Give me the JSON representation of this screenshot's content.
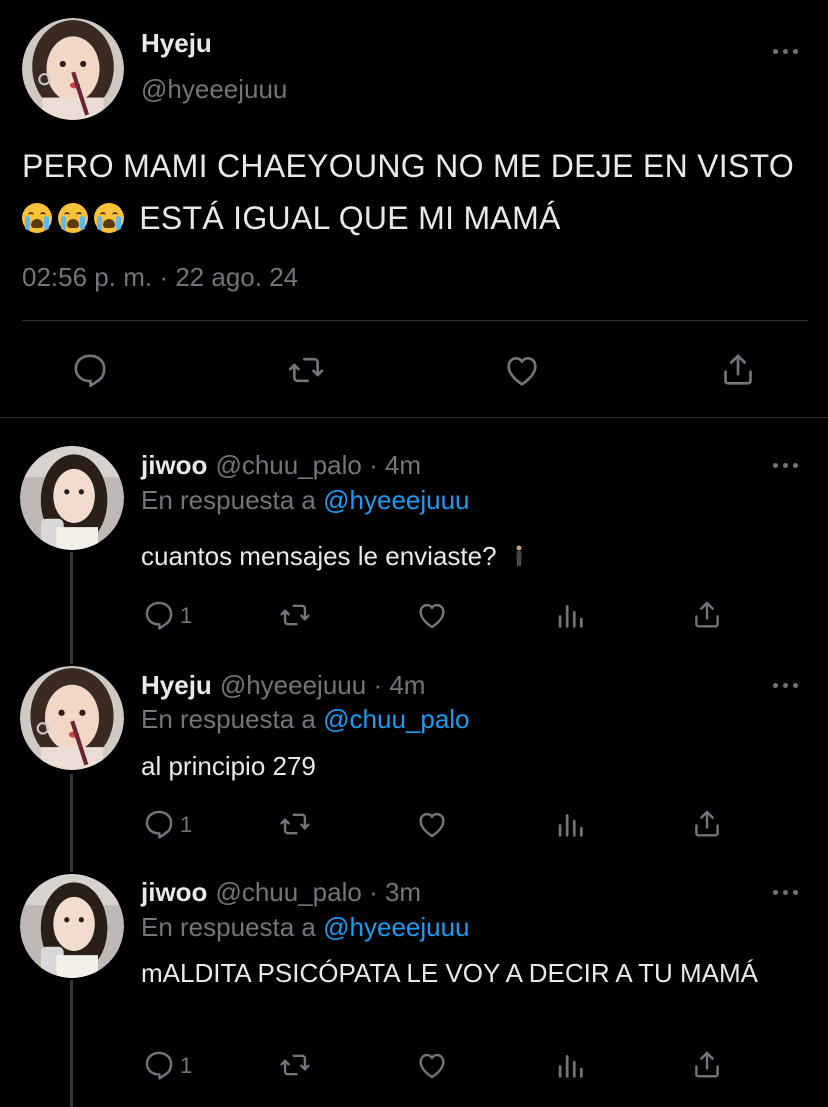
{
  "main_tweet": {
    "author_name": "Hyeju",
    "author_handle": "@hyeeejuuu",
    "text_part1": "PERO MAMI CHAEYOUNG NO ME DEJE EN VISTO",
    "emoji": "loudly-crying-face",
    "emoji_count": 3,
    "text_part2": "ESTÁ IGUAL QUE MI MAMÁ",
    "time": "02:56 p. m.",
    "separator": "·",
    "date": "22 ago. 24",
    "actions": [
      "reply-icon",
      "retweet-icon",
      "like-icon",
      "share-icon"
    ]
  },
  "replies": [
    {
      "name": "jiwoo",
      "handle": "@chuu_palo",
      "sep": "·",
      "time": "4m",
      "in_reply_prefix": "En respuesta a",
      "in_reply_to": "@hyeeejuuu",
      "text": "cuantos mensajes le enviaste?",
      "trailing_icon": "person-standing-icon",
      "reply_count": "1"
    },
    {
      "name": "Hyeju",
      "handle": "@hyeeejuuu",
      "sep": "·",
      "time": "4m",
      "in_reply_prefix": "En respuesta a",
      "in_reply_to": "@chuu_palo",
      "text": "al principio 279",
      "reply_count": "1"
    },
    {
      "name": "jiwoo",
      "handle": "@chuu_palo",
      "sep": "·",
      "time": "3m",
      "in_reply_prefix": "En respuesta a",
      "in_reply_to": "@hyeeejuuu",
      "text": "mALDITA PSICÓPATA LE VOY A DECIR A TU MAMÁ",
      "reply_count": "1"
    }
  ],
  "colors": {
    "background": "#000000",
    "text": "#e7e9ea",
    "secondary": "#71767b",
    "link": "#1d9bf0",
    "divider": "#2f3336"
  }
}
